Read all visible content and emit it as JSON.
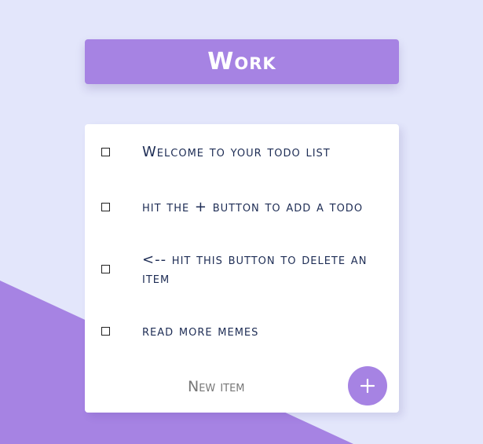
{
  "colors": {
    "background": "#e3e6fb",
    "accent": "#a683e3",
    "card": "#ffffff",
    "item_text": "#1e2d55",
    "placeholder": "#777777"
  },
  "header": {
    "title": "Work"
  },
  "todos": [
    {
      "label": "Welcome to your todo list",
      "checked": false
    },
    {
      "label": "hit the + button to add a todo",
      "checked": false
    },
    {
      "label": "<-- hit this button to delete an item",
      "checked": false
    },
    {
      "label": "read more memes",
      "checked": false
    }
  ],
  "new_item": {
    "placeholder": "New item",
    "value": ""
  },
  "add_button": {
    "icon": "plus-icon"
  }
}
